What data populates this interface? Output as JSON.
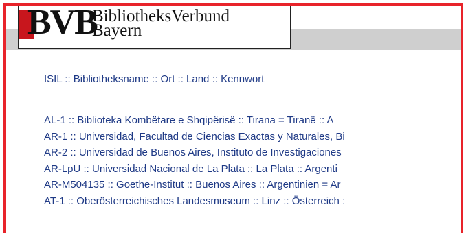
{
  "logo": {
    "abbr": "BVB",
    "line1": "BibliotheksVerbund",
    "line2": "Bayern"
  },
  "columns_header": "ISIL :: Bibliotheksname :: Ort :: Land :: Kennwort",
  "entries": [
    "AL-1 :: Biblioteka Kombëtare e Shqipërisë :: Tirana = Tiranë :: A",
    "AR-1 :: Universidad, Facultad de Ciencias Exactas y Naturales, Bi",
    "AR-2 :: Universidad de Buenos Aires, Instituto de Investigaciones",
    "AR-LpU :: Universidad Nacional de La Plata :: La Plata :: Argenti",
    "AR-M504135 :: Goethe-Institut :: Buenos Aires :: Argentinien = Ar",
    "AT-1 :: Oberösterreichisches Landesmuseum :: Linz :: Österreich :"
  ],
  "colors": {
    "frame_border": "#e8232a",
    "link": "#1f3a86",
    "header_band": "#cfcfcf",
    "logo_red": "#c8161d"
  }
}
